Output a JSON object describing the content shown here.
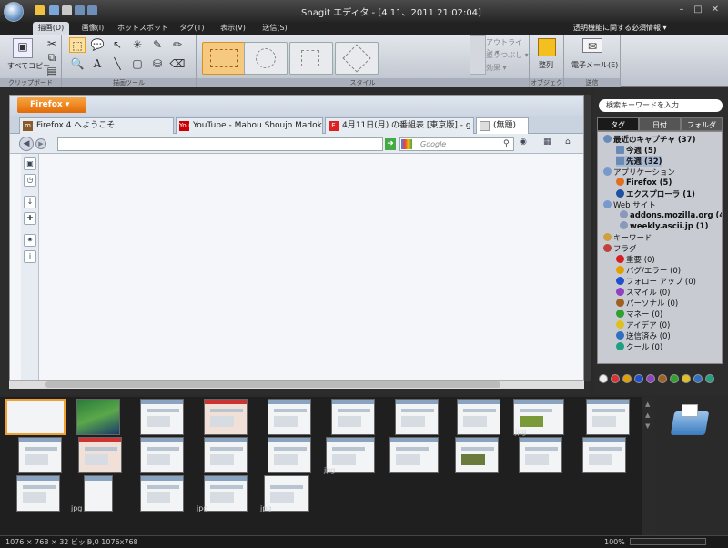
{
  "window": {
    "title": "Snagit エディタ - [4 11、2011 21:02:04]",
    "minimize": "–",
    "maximize": "□",
    "close": "✕"
  },
  "ribbon_tabs": [
    "描画(D)",
    "画像(I)",
    "ホットスポット(H)",
    "タグ(T)",
    "表示(V)",
    "送信(S)"
  ],
  "help_link": "透明機能に関する必須情報 ▾",
  "ribbon": {
    "clipboard": {
      "label": "クリップボード",
      "copy_all": "すべてコピー"
    },
    "drawing_tools": {
      "label": "描画ツール"
    },
    "style": {
      "label": "スタイル",
      "outline": "アウトライン ▾",
      "fill": "塗りつぶし ▾",
      "effects": "効果 ▾"
    },
    "object": {
      "label": "オブジェクト",
      "arrange": "整列"
    },
    "send": {
      "label": "送信",
      "email": "電子メール(E)"
    }
  },
  "browser": {
    "menu_button": "Firefox ▾",
    "tabs": [
      {
        "icon": "m",
        "title": "Firefox 4 へようこそ"
      },
      {
        "icon": "You",
        "title": "YouTube - Mahou Shoujo Madoka..."
      },
      {
        "icon": "E",
        "title": "4月11日(月) の番組表 [東京版] - g..."
      },
      {
        "icon": "",
        "title": "(無題)"
      }
    ],
    "search_placeholder": "Google"
  },
  "library": {
    "search_placeholder": "検索キーワードを入力",
    "tabs": [
      "タグ",
      "日付",
      "フォルダ"
    ],
    "tree": [
      {
        "label": "最近のキャプチャ (37)",
        "bold": true,
        "indent": 0
      },
      {
        "label": "今週 (5)",
        "bold": true,
        "indent": 1
      },
      {
        "label": "先週 (32)",
        "bold": true,
        "indent": 1,
        "selected": true
      },
      {
        "label": "アプリケーション",
        "bold": false,
        "indent": 0
      },
      {
        "label": "Firefox (5)",
        "bold": true,
        "indent": 1
      },
      {
        "label": "エクスプローラ (1)",
        "bold": true,
        "indent": 1
      },
      {
        "label": "Web サイト",
        "bold": false,
        "indent": 0
      },
      {
        "label": "addons.mozilla.org (4)",
        "bold": true,
        "indent": 2
      },
      {
        "label": "weekly.ascii.jp (1)",
        "bold": true,
        "indent": 2
      },
      {
        "label": "キーワード",
        "bold": false,
        "indent": 0
      },
      {
        "label": "フラグ",
        "bold": false,
        "indent": 0
      },
      {
        "label": "重要 (0)",
        "bold": false,
        "indent": 1,
        "color": "#d42020"
      },
      {
        "label": "バグ/エラー (0)",
        "bold": false,
        "indent": 1,
        "color": "#e0a000"
      },
      {
        "label": "フォロー アップ (0)",
        "bold": false,
        "indent": 1,
        "color": "#2050d0"
      },
      {
        "label": "スマイル (0)",
        "bold": false,
        "indent": 1,
        "color": "#9040c0"
      },
      {
        "label": "パーソナル (0)",
        "bold": false,
        "indent": 1,
        "color": "#a06020"
      },
      {
        "label": "マネー (0)",
        "bold": false,
        "indent": 1,
        "color": "#30a030"
      },
      {
        "label": "アイデア (0)",
        "bold": false,
        "indent": 1,
        "color": "#e0c020"
      },
      {
        "label": "送信済み (0)",
        "bold": false,
        "indent": 1,
        "color": "#3070c0"
      },
      {
        "label": "クール (0)",
        "bold": false,
        "indent": 1,
        "color": "#20a080"
      }
    ]
  },
  "thumbnails": {
    "jpg_label": "jpg"
  },
  "status": {
    "left": "1076 × 768 × 32 ビット",
    "coords": "0,0  1076x768",
    "zoom": "100%"
  }
}
